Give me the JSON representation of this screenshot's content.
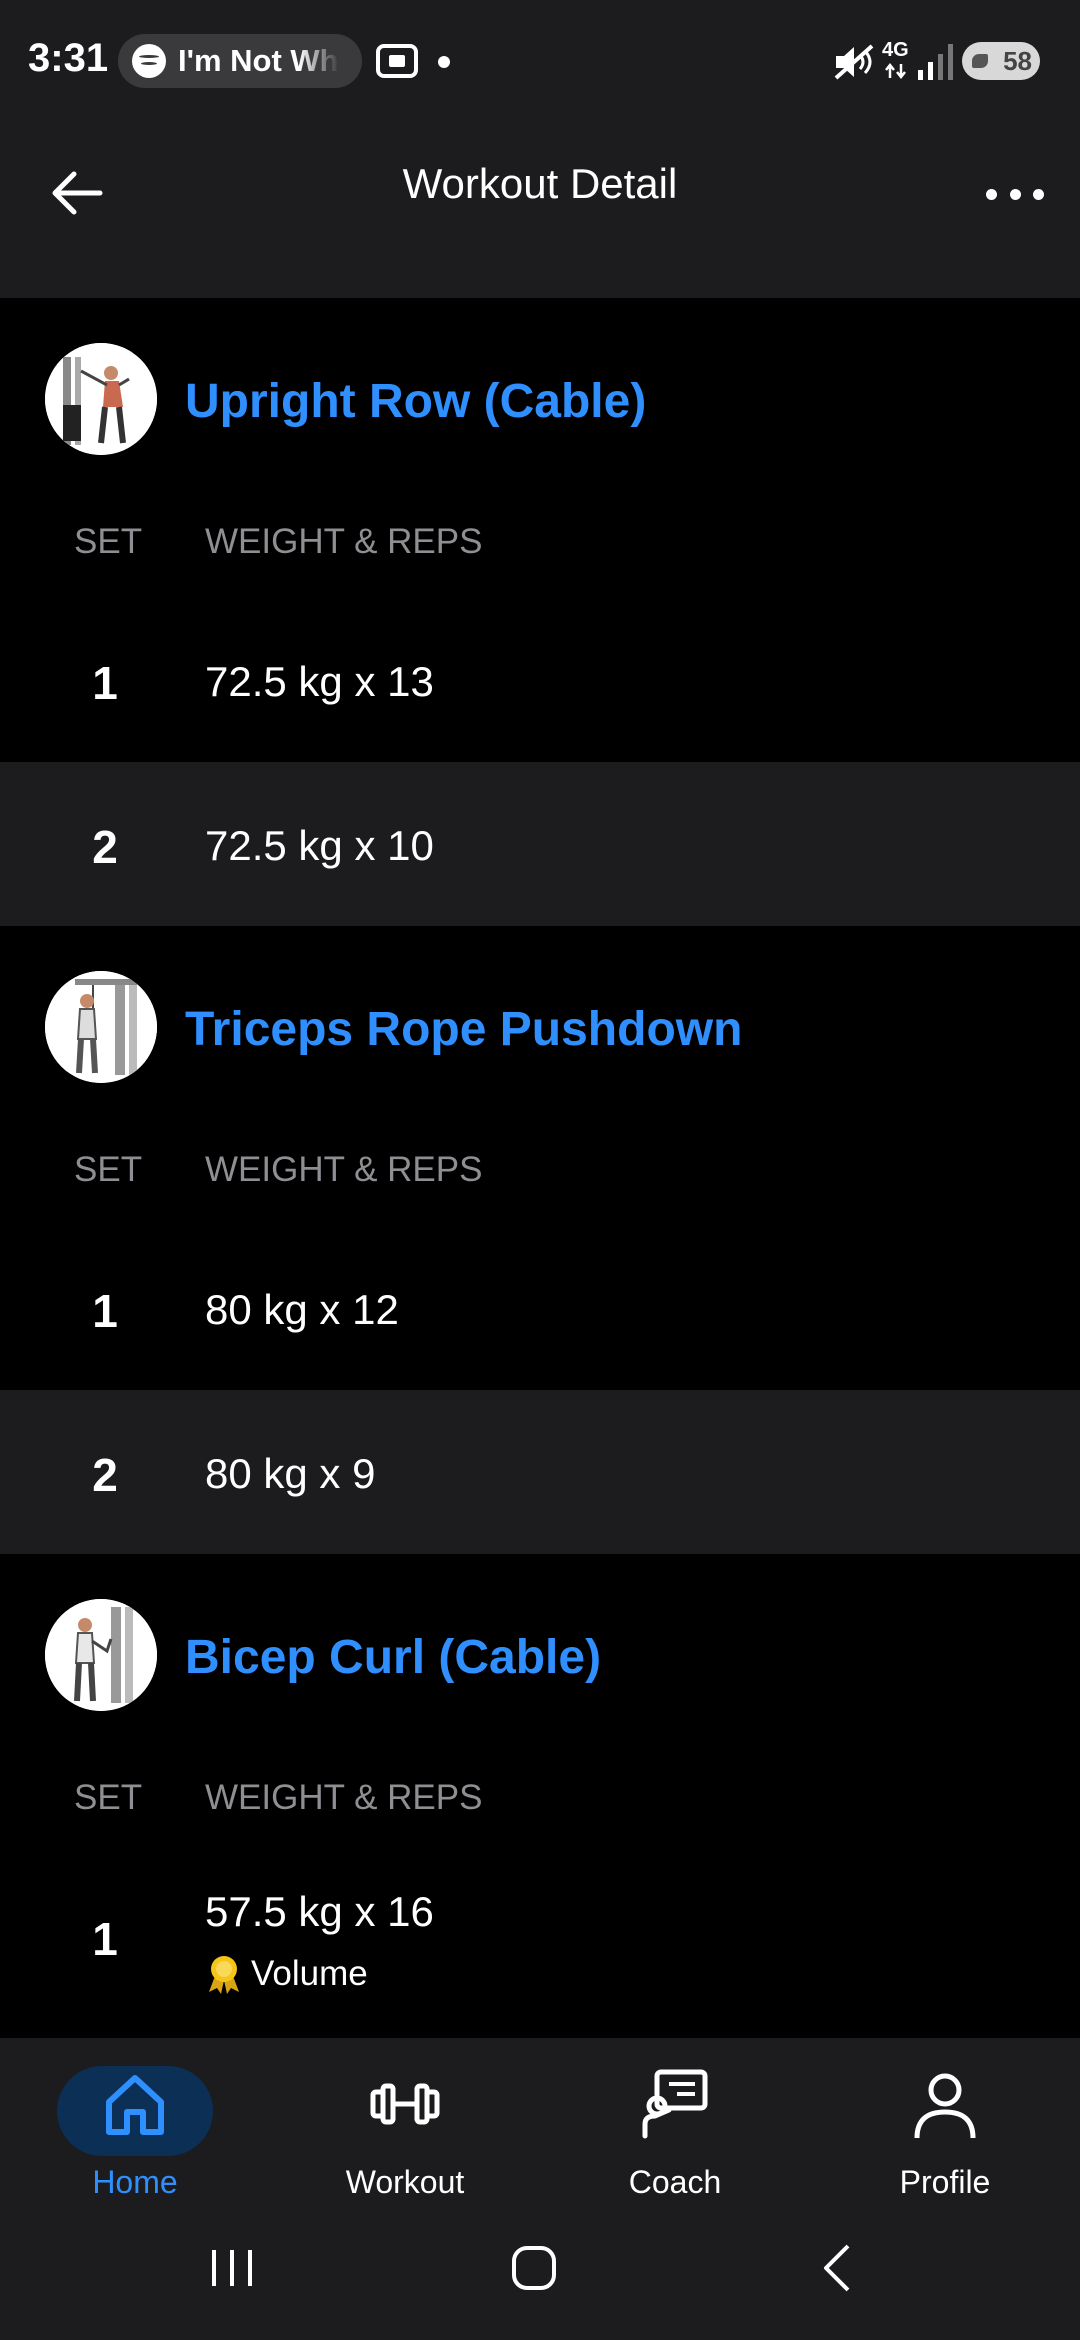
{
  "status_bar": {
    "time": "3:31",
    "media_pill_text": "I'm Not Wh",
    "network": "4G",
    "battery": "58"
  },
  "header": {
    "title": "Workout Detail"
  },
  "columns": {
    "set": "SET",
    "weight_reps": "WEIGHT & REPS"
  },
  "exercises": [
    {
      "name": "Upright Row (Cable)",
      "sets": [
        {
          "num": "1",
          "value": "72.5 kg x 13"
        },
        {
          "num": "2",
          "value": "72.5 kg x 10"
        }
      ]
    },
    {
      "name": "Triceps Rope Pushdown",
      "sets": [
        {
          "num": "1",
          "value": "80 kg x 12"
        },
        {
          "num": "2",
          "value": "80 kg x 9"
        }
      ]
    },
    {
      "name": "Bicep Curl (Cable)",
      "sets": [
        {
          "num": "1",
          "value": "57.5 kg x 16",
          "badge": "Volume"
        }
      ]
    }
  ],
  "nav": {
    "items": [
      {
        "label": "Home",
        "icon": "home-icon",
        "active": true
      },
      {
        "label": "Workout",
        "icon": "dumbbell-icon",
        "active": false
      },
      {
        "label": "Coach",
        "icon": "coach-icon",
        "active": false
      },
      {
        "label": "Profile",
        "icon": "person-icon",
        "active": false
      }
    ]
  },
  "colors": {
    "accent": "#2f8fff",
    "surface": "#1c1c1e",
    "background": "#000000",
    "muted_text": "#8e8e93",
    "badge_gold": "#f5c518"
  }
}
